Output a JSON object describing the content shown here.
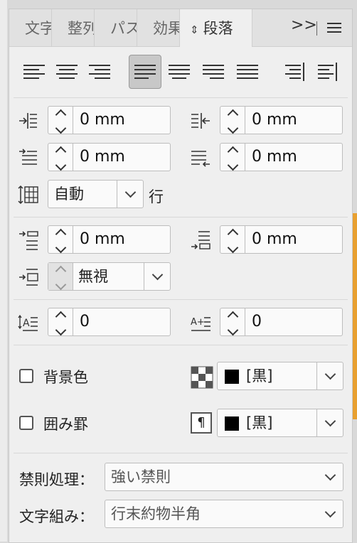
{
  "tabs": [
    {
      "label": "文字",
      "active": false
    },
    {
      "label": "整列",
      "active": false
    },
    {
      "label": "パス",
      "active": false
    },
    {
      "label": "効果",
      "active": false
    },
    {
      "label": "段落",
      "active": true
    }
  ],
  "tab_overflow": ">>",
  "alignment": {
    "buttons": [
      "align-left",
      "align-center",
      "align-right",
      "justify-left",
      "justify-center",
      "justify-right",
      "justify-all",
      "align-towards-spine",
      "align-away-from-spine"
    ],
    "selected": "justify-left"
  },
  "indents": {
    "left": "0 mm",
    "right": "0 mm",
    "first_line": "0 mm",
    "last_line": "0 mm"
  },
  "grid": {
    "value": "自動",
    "unit_label": "行"
  },
  "spacing": {
    "before": "0 mm",
    "after": "0 mm",
    "grid_align": "無視"
  },
  "drop_cap": {
    "lines": "0",
    "chars": "0"
  },
  "shading": {
    "label": "背景色",
    "checked": false,
    "color": "[黒]",
    "swatch": "#000000"
  },
  "border": {
    "label": "囲み罫",
    "checked": false,
    "color": "[黒]",
    "swatch": "#000000"
  },
  "kinsoku": {
    "label": "禁則処理：",
    "value": "強い禁則"
  },
  "mojikumi": {
    "label": "文字組み：",
    "value": "行末約物半角"
  }
}
